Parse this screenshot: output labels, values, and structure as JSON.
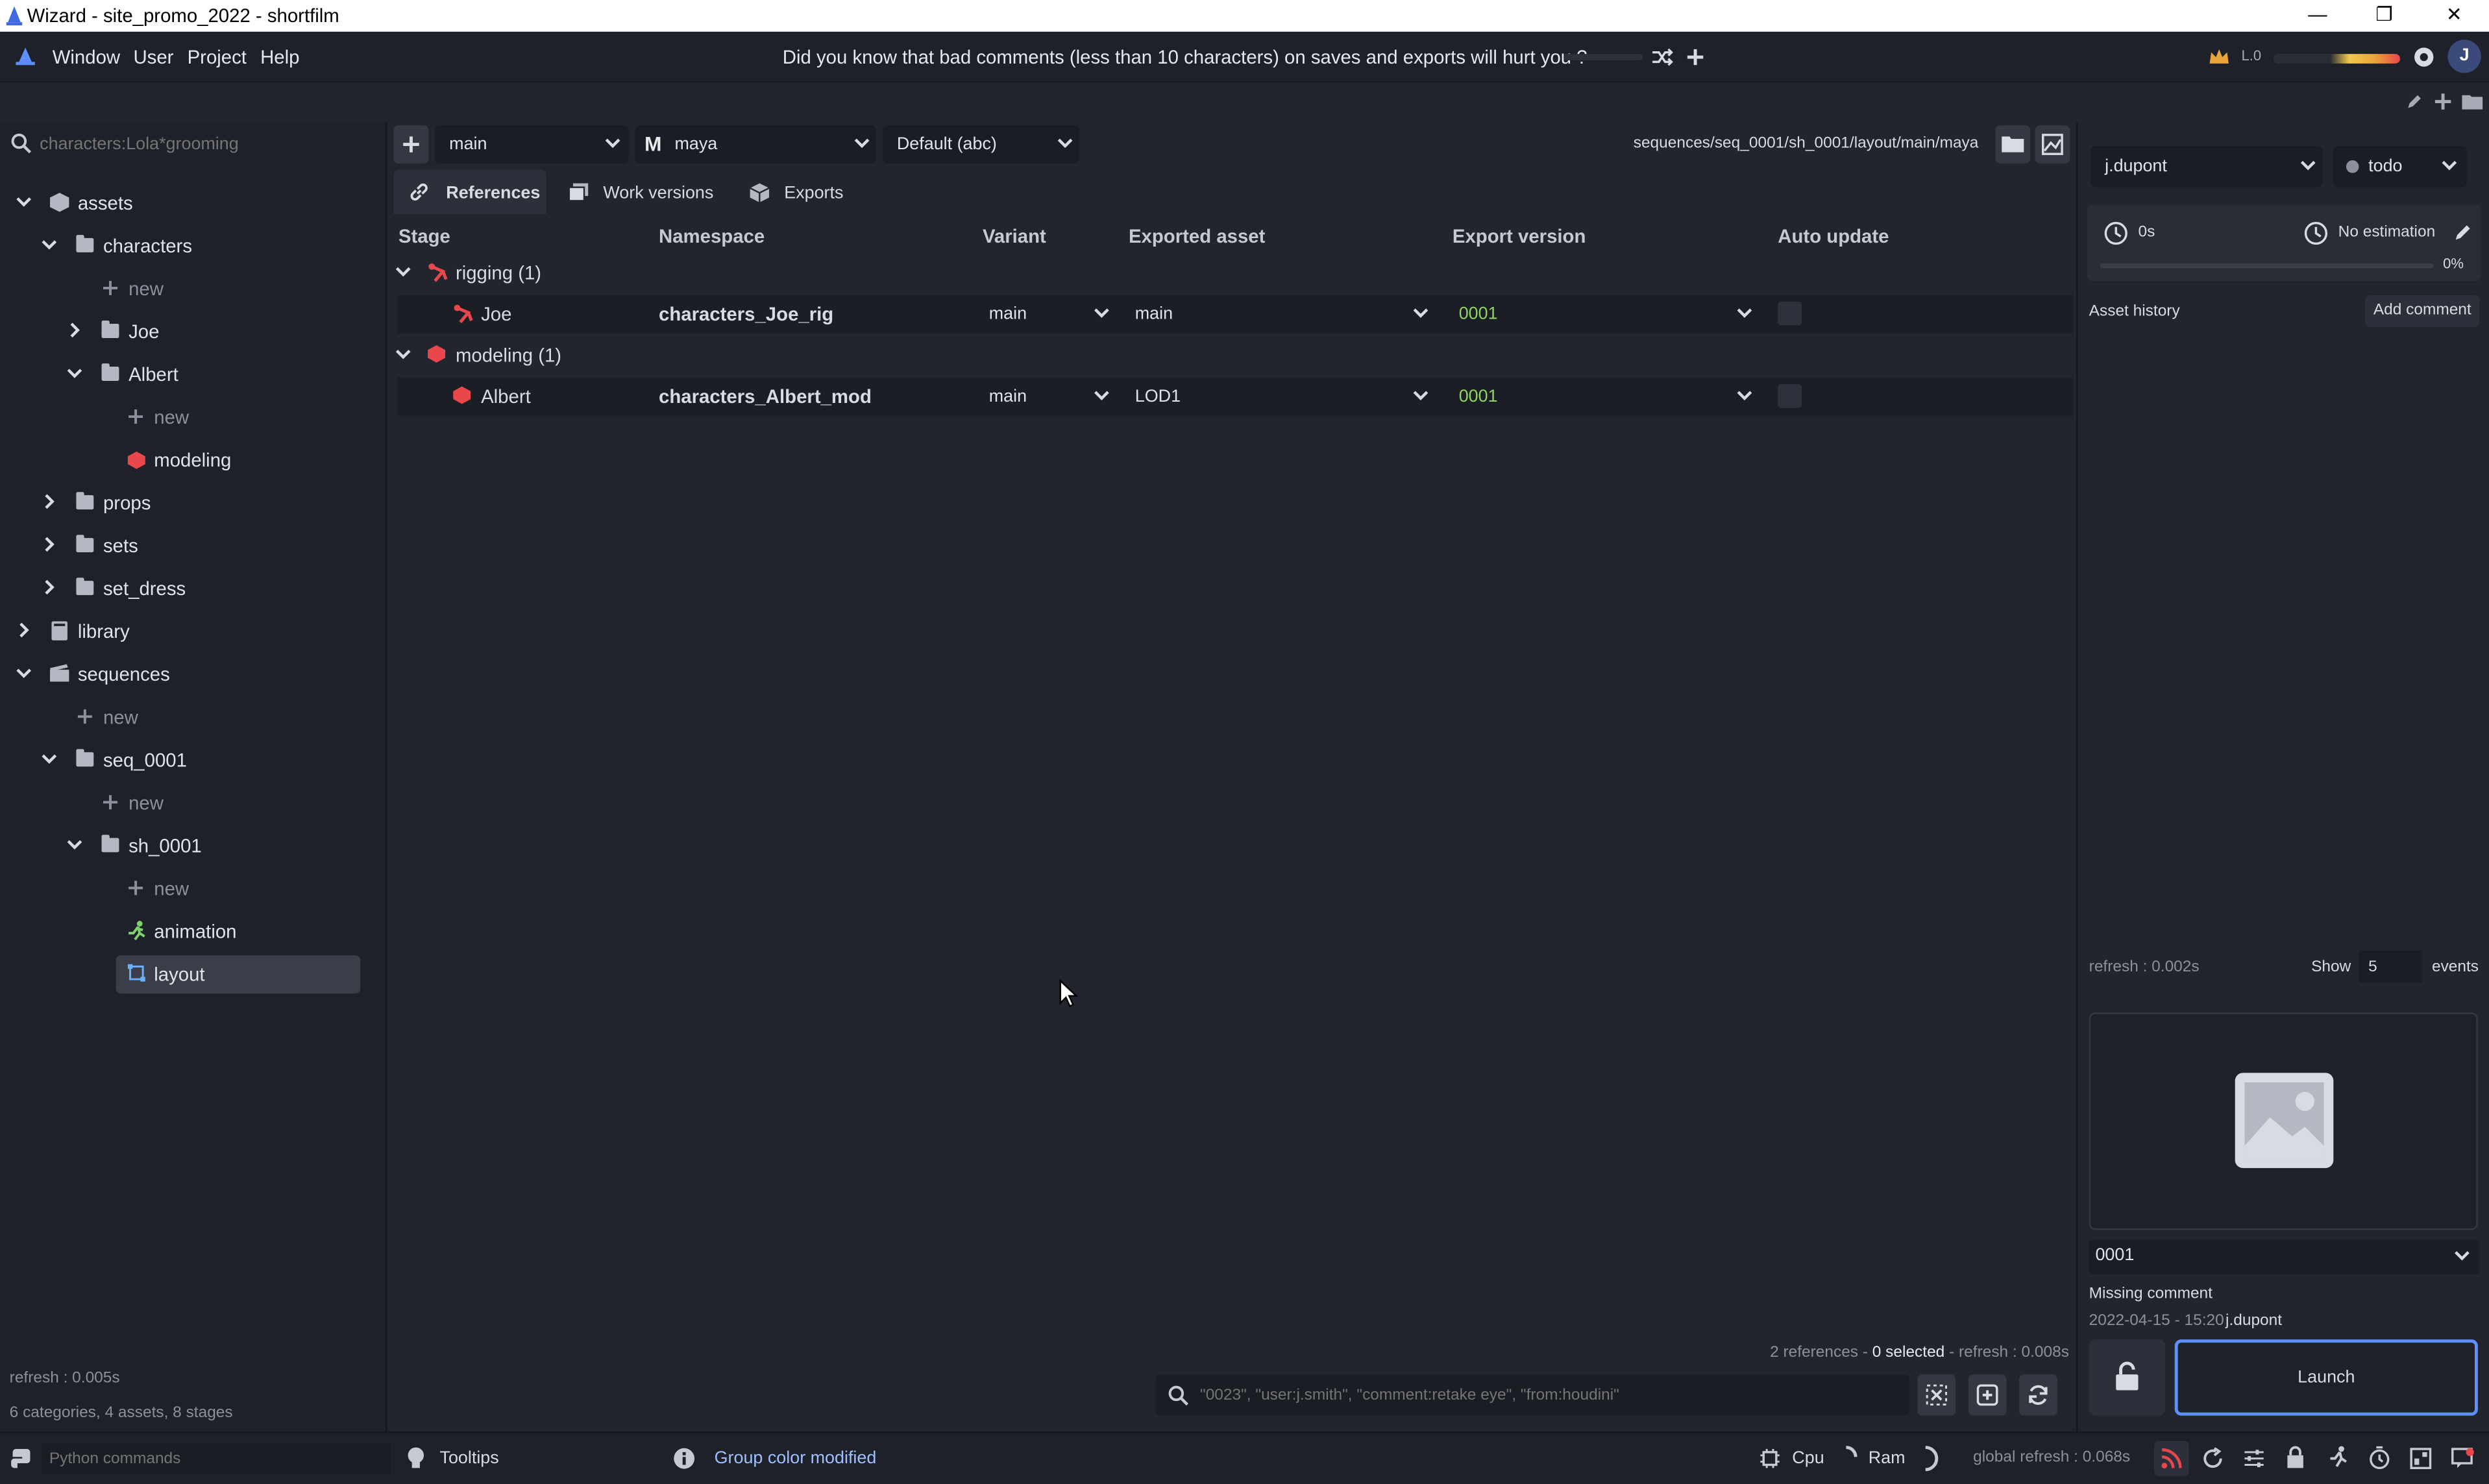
{
  "window": {
    "title": "Wizard - site_promo_2022 - shortfilm",
    "minimize": "—",
    "maximize": "❐",
    "close": "✕"
  },
  "menu": {
    "items": [
      "Window",
      "User",
      "Project",
      "Help"
    ],
    "tip": "Did you know that bad comments (less than 10 characters) on saves and exports will hurt you ?",
    "level": "L.0",
    "avatar_letter": "J"
  },
  "left": {
    "search_placeholder": "characters:Lola*grooming",
    "tree": [
      {
        "label": "assets"
      },
      {
        "label": "characters"
      },
      {
        "label": "new"
      },
      {
        "label": "Joe"
      },
      {
        "label": "Albert"
      },
      {
        "label": "new"
      },
      {
        "label": "modeling"
      },
      {
        "label": "props"
      },
      {
        "label": "sets"
      },
      {
        "label": "set_dress"
      },
      {
        "label": "library"
      },
      {
        "label": "sequences"
      },
      {
        "label": "new"
      },
      {
        "label": "seq_0001"
      },
      {
        "label": "new"
      },
      {
        "label": "sh_0001"
      },
      {
        "label": "new"
      },
      {
        "label": "animation"
      },
      {
        "label": "layout"
      }
    ],
    "refresh": "refresh : 0.005s",
    "stats": "6 categories, 4 assets, 8 stages"
  },
  "center": {
    "variant_combo": "main",
    "software_combo": "maya",
    "software_icon": "M",
    "state_combo": "Default (abc)",
    "path": "sequences/seq_0001/sh_0001/layout/main/maya",
    "tabs": [
      "References",
      "Work versions",
      "Exports"
    ],
    "columns": [
      "Stage",
      "Namespace",
      "Variant",
      "Exported asset",
      "Export version",
      "Auto update"
    ],
    "groups": [
      {
        "label": "rigging (1)",
        "color": "#e8474b",
        "rows": [
          {
            "stage": "Joe",
            "namespace": "characters_Joe_rig",
            "variant": "main",
            "exported_asset": "main",
            "export_version": "0001"
          }
        ]
      },
      {
        "label": "modeling (1)",
        "color": "#e8474b",
        "rows": [
          {
            "stage": "Albert",
            "namespace": "characters_Albert_mod",
            "variant": "main",
            "exported_asset": "LOD1",
            "export_version": "0001"
          }
        ]
      }
    ],
    "status": {
      "refs": "2 references - ",
      "selected": "0 selected",
      "refresh": " - refresh : 0.008s"
    },
    "filter_placeholder": "\"0023\", \"user:j.smith\", \"comment:retake eye\", \"from:houdini\""
  },
  "right": {
    "user_combo": "j.dupont",
    "state_combo": "todo",
    "time": "0s",
    "estimation": "No estimation",
    "progress": "0%",
    "progress_value": 0,
    "history_label": "Asset history",
    "add_comment": "Add comment",
    "refresh": "refresh : 0.002s",
    "show_label": "Show",
    "show_value": "5",
    "events_label": "events",
    "version_combo": "0001",
    "missing_comment": "Missing comment",
    "date": "2022-04-15 - 15:20",
    "author": "j.dupont",
    "launch": "Launch"
  },
  "bottom": {
    "python_placeholder": "Python commands",
    "tooltips": "Tooltips",
    "notice": "Group color modified",
    "cpu": "Cpu",
    "ram": "Ram",
    "global_refresh": "global refresh : 0.068s"
  },
  "colors": {
    "accent": "#5f8fff",
    "version_green": "#8fd45e",
    "stage_red": "#e8474b",
    "notice_blue": "#9ec0ff"
  }
}
